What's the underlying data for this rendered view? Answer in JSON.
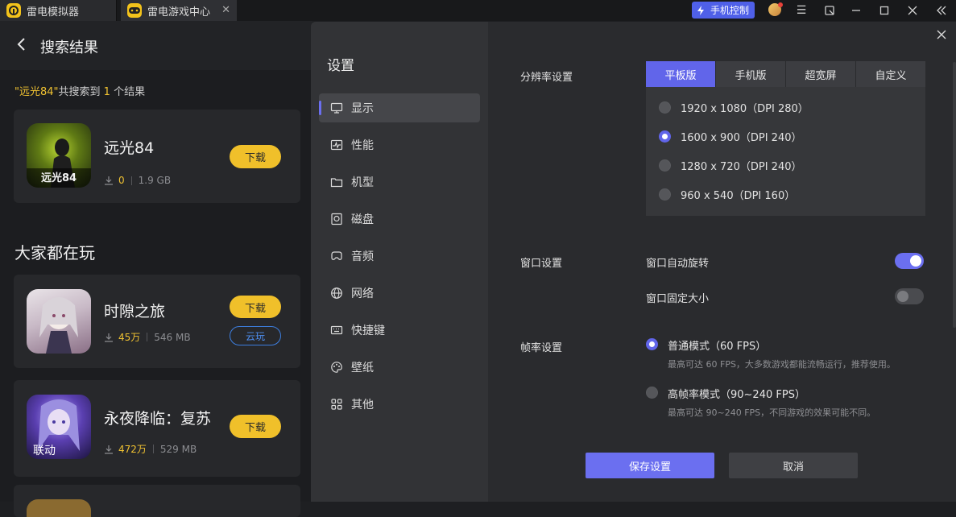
{
  "titlebar": {
    "tabs": [
      {
        "label": "雷电模拟器",
        "icon": "ldplayer-logo-icon"
      },
      {
        "label": "雷电游戏中心",
        "icon": "game-center-icon"
      }
    ],
    "phone_control": "手机控制"
  },
  "left": {
    "title": "搜索结果",
    "summary": {
      "prefix": "\"",
      "query": "远光84",
      "middle": "\"共搜索到 ",
      "count": "1",
      "suffix": " 个结果"
    },
    "result": {
      "name": "远光84",
      "downloads": "0",
      "size": "1.9 GB",
      "download_label": "下载",
      "icon_text": "远光84"
    },
    "section_title": "大家都在玩",
    "popular": [
      {
        "name": "时隙之旅",
        "downloads": "45万",
        "size": "546 MB",
        "download_label": "下载",
        "cloud_label": "云玩"
      },
      {
        "name": "永夜降临：复苏",
        "downloads": "472万",
        "size": "529 MB",
        "download_label": "下载",
        "icon_text": "联动"
      }
    ]
  },
  "dialog": {
    "title": "设置",
    "nav": [
      {
        "label": "显示",
        "icon": "monitor-icon",
        "active": true
      },
      {
        "label": "性能",
        "icon": "performance-icon"
      },
      {
        "label": "机型",
        "icon": "device-icon"
      },
      {
        "label": "磁盘",
        "icon": "disk-icon"
      },
      {
        "label": "音频",
        "icon": "audio-icon"
      },
      {
        "label": "网络",
        "icon": "globe-icon"
      },
      {
        "label": "快捷键",
        "icon": "keyboard-icon"
      },
      {
        "label": "壁纸",
        "icon": "palette-icon"
      },
      {
        "label": "其他",
        "icon": "grid-icon"
      }
    ],
    "resolution": {
      "label": "分辨率设置",
      "tabs": [
        "平板版",
        "手机版",
        "超宽屏",
        "自定义"
      ],
      "selected_tab": "平板版",
      "options": [
        "1920 x 1080（DPI 280）",
        "1600 x 900（DPI 240）",
        "1280 x 720（DPI 240）",
        "960 x 540（DPI 160）"
      ],
      "selected": "1600 x 900（DPI 240）"
    },
    "window": {
      "label": "窗口设置",
      "auto_rotate": "窗口自动旋转",
      "auto_rotate_on": true,
      "fixed_size": "窗口固定大小",
      "fixed_size_on": false
    },
    "fps": {
      "label": "帧率设置",
      "normal_title": "普通模式（60 FPS）",
      "normal_desc": "最高可达 60 FPS，大多数游戏都能流畅运行，推荐使用。",
      "high_title": "高帧率模式（90~240 FPS）",
      "high_desc": "最高可达 90~240 FPS，不同游戏的效果可能不同。",
      "selected": "normal"
    },
    "save_label": "保存设置",
    "cancel_label": "取消"
  },
  "colors": {
    "accent": "#6b6ff0",
    "download_button": "#f0c02a",
    "highlight": "#f0c231",
    "cloud": "#3d7fe0"
  }
}
